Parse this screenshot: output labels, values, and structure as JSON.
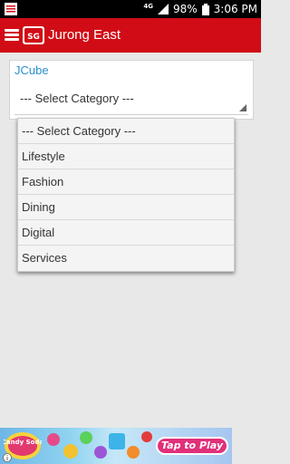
{
  "status_bar": {
    "network": "4G",
    "battery": "98%",
    "time": "3:06 PM"
  },
  "header": {
    "title": "Jurong East",
    "logo_text": "SG"
  },
  "card": {
    "location": "JCube",
    "select_value": "--- Select Category ---"
  },
  "dropdown": {
    "options": [
      "--- Select Category ---",
      "Lifestyle",
      "Fashion",
      "Dining",
      "Digital",
      "Services"
    ]
  },
  "ad": {
    "cta": "Tap to Play",
    "logo_text": "Candy Soda"
  },
  "colors": {
    "header_red": "#d10c16",
    "link_blue": "#2a8fcf",
    "background": "#e8e8e8"
  }
}
